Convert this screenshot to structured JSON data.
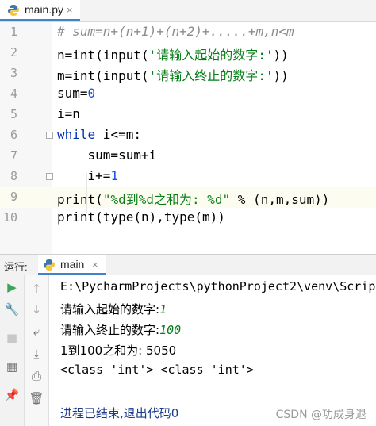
{
  "editor_tab": {
    "filename": "main.py",
    "close_glyph": "×",
    "icon": "python-file-icon"
  },
  "code_lines": [
    {
      "n": "1",
      "tokens": [
        {
          "t": "# sum=n+(n+1)+(n+2)+.....+m,n<m",
          "c": "cm"
        }
      ]
    },
    {
      "n": "2",
      "tokens": [
        {
          "t": "n=",
          "c": ""
        },
        {
          "t": "int",
          "c": ""
        },
        {
          "t": "(",
          "c": ""
        },
        {
          "t": "input",
          "c": ""
        },
        {
          "t": "(",
          "c": ""
        },
        {
          "t": "'请输入起始的数字:'",
          "c": "str"
        },
        {
          "t": "))",
          "c": ""
        }
      ]
    },
    {
      "n": "3",
      "tokens": [
        {
          "t": "m=",
          "c": ""
        },
        {
          "t": "int",
          "c": ""
        },
        {
          "t": "(",
          "c": ""
        },
        {
          "t": "input",
          "c": ""
        },
        {
          "t": "(",
          "c": ""
        },
        {
          "t": "'请输入终止的数字:'",
          "c": "str"
        },
        {
          "t": "))",
          "c": ""
        }
      ]
    },
    {
      "n": "4",
      "tokens": [
        {
          "t": "sum=",
          "c": ""
        },
        {
          "t": "0",
          "c": "num"
        }
      ]
    },
    {
      "n": "5",
      "tokens": [
        {
          "t": "i=n",
          "c": ""
        }
      ]
    },
    {
      "n": "6",
      "tokens": [
        {
          "t": "while",
          "c": "kw"
        },
        {
          "t": " i<=m:",
          "c": ""
        }
      ]
    },
    {
      "n": "7",
      "tokens": [
        {
          "t": "    sum=sum+i",
          "c": ""
        }
      ]
    },
    {
      "n": "8",
      "tokens": [
        {
          "t": "    i+=",
          "c": ""
        },
        {
          "t": "1",
          "c": "num"
        }
      ]
    },
    {
      "n": "9",
      "tokens": [
        {
          "t": "print",
          "c": ""
        },
        {
          "t": "(",
          "c": ""
        },
        {
          "t": "\"%d到%d之和为: %d\"",
          "c": "str"
        },
        {
          "t": " % (n,m,sum))",
          "c": ""
        }
      ]
    },
    {
      "n": "10",
      "tokens": [
        {
          "t": "print",
          "c": ""
        },
        {
          "t": "(",
          "c": ""
        },
        {
          "t": "type",
          "c": ""
        },
        {
          "t": "(n),",
          "c": ""
        },
        {
          "t": "type",
          "c": ""
        },
        {
          "t": "(m))",
          "c": ""
        }
      ]
    }
  ],
  "run_panel": {
    "label": "运行:",
    "tab_name": "main",
    "close_glyph": "×",
    "left_toolbar": [
      {
        "name": "run-icon",
        "glyph": "▶",
        "color": "#3aa655"
      },
      {
        "name": "wrench-icon",
        "glyph": "🔧",
        "color": "#6e6e6e"
      },
      {
        "name": "stop-icon",
        "glyph": "■",
        "color": "#c8c8c8"
      },
      {
        "name": "layout-icon",
        "glyph": "▦",
        "color": "#6e6e6e"
      },
      {
        "name": "pin-icon",
        "glyph": "📌",
        "color": "#6e6e6e"
      }
    ],
    "right_toolbar": [
      {
        "name": "up-arrow-icon",
        "glyph": "↑",
        "color": "#b0b0b0"
      },
      {
        "name": "down-arrow-icon",
        "glyph": "↓",
        "color": "#b0b0b0"
      },
      {
        "name": "soft-wrap-icon",
        "glyph": "⤶",
        "color": "#6e6e6e"
      },
      {
        "name": "scroll-to-end-icon",
        "glyph": "⤓",
        "color": "#6e6e6e"
      },
      {
        "name": "print-icon",
        "glyph": "⎙",
        "color": "#6e6e6e"
      },
      {
        "name": "trash-icon",
        "glyph": "🗑",
        "color": "#6e6e6e"
      }
    ]
  },
  "console": {
    "path": "E:\\PycharmProjects\\pythonProject2\\venv\\Scrip",
    "prompt1": "请输入起始的数字:",
    "input1": "1",
    "prompt2": "请输入终止的数字:",
    "input2": "100",
    "result_line": "1到100之和为: 5050",
    "type_line": "<class 'int'> <class 'int'>",
    "exit_line": "进程已结束,退出代码0"
  },
  "watermark": "CSDN @功成身退",
  "colors": {
    "accent": "#4083c9",
    "keyword": "#0033b3",
    "string": "#067d17",
    "number": "#1750eb",
    "comment": "#8c8c8c"
  }
}
